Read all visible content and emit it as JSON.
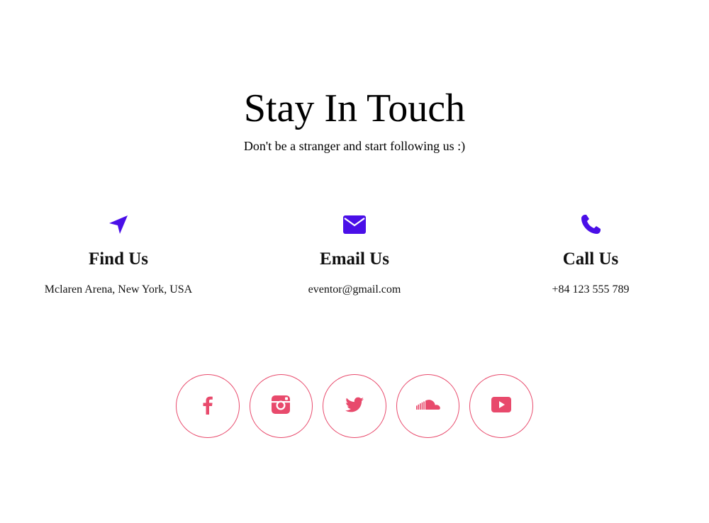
{
  "hero": {
    "title": "Stay In Touch",
    "subtitle": "Don't be a stranger and start following us :)"
  },
  "contacts": [
    {
      "icon": "location-arrow-icon",
      "title": "Find Us",
      "value": "Mclaren Arena, New York, USA"
    },
    {
      "icon": "envelope-icon",
      "title": "Email Us",
      "value": "eventor@gmail.com"
    },
    {
      "icon": "phone-icon",
      "title": "Call Us",
      "value": "+84 123 555 789"
    }
  ],
  "social": [
    {
      "icon": "facebook-icon"
    },
    {
      "icon": "instagram-icon"
    },
    {
      "icon": "twitter-icon"
    },
    {
      "icon": "soundcloud-icon"
    },
    {
      "icon": "youtube-icon"
    }
  ],
  "colors": {
    "icon_accent": "#4a0fe8",
    "social_accent": "#e84a6c"
  }
}
